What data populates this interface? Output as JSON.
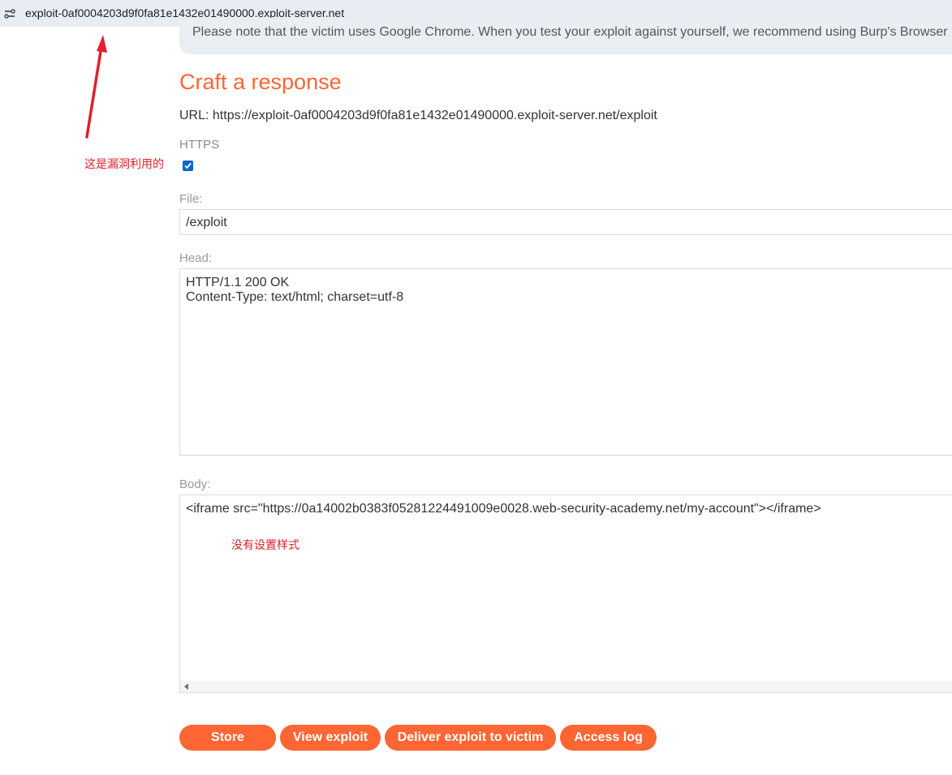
{
  "browser": {
    "url": "exploit-0af0004203d9f0fa81e1432e01490000.exploit-server.net"
  },
  "notice": {
    "text": "Please note that the victim uses Google Chrome. When you test your exploit against yourself, we recommend using Burp's Browser"
  },
  "form": {
    "heading": "Craft a response",
    "url_line": "URL: https://exploit-0af0004203d9f0fa81e1432e01490000.exploit-server.net/exploit",
    "https_label": "HTTPS",
    "https_checked": true,
    "file_label": "File:",
    "file_value": "/exploit",
    "head_label": "Head:",
    "head_value": "HTTP/1.1 200 OK\nContent-Type: text/html; charset=utf-8",
    "body_label": "Body:",
    "body_value": "<iframe src=\"https://0a14002b0383f05281224491009e0028.web-security-academy.net/my-account\"></iframe>"
  },
  "buttons": {
    "store": "Store",
    "view_exploit": "View exploit",
    "deliver": "Deliver exploit to victim",
    "access_log": "Access log"
  },
  "annotations": {
    "exploit_note": "这是漏洞利用的",
    "style_note": "没有设置样式"
  },
  "colors": {
    "accent": "#ff6633",
    "annotation": "#e0202a",
    "checkbox": "#0a66c8"
  }
}
